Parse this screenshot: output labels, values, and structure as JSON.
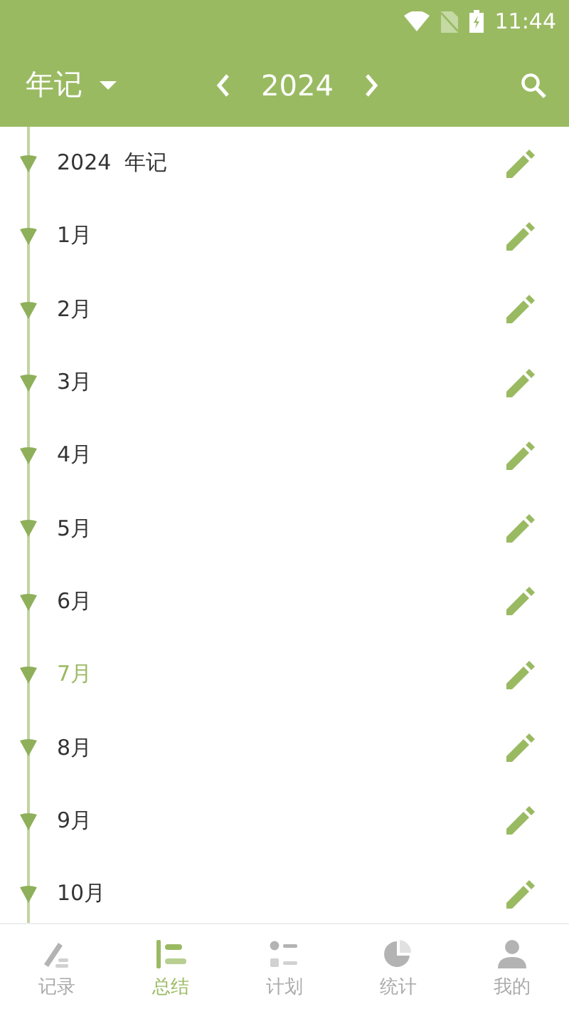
{
  "status_bar": {
    "time": "11:44"
  },
  "header": {
    "view_label": "年记",
    "year": "2024"
  },
  "timeline": [
    {
      "label": "2024  年记",
      "selected": false
    },
    {
      "label": "1月",
      "selected": false
    },
    {
      "label": "2月",
      "selected": false
    },
    {
      "label": "3月",
      "selected": false
    },
    {
      "label": "4月",
      "selected": false
    },
    {
      "label": "5月",
      "selected": false
    },
    {
      "label": "6月",
      "selected": false
    },
    {
      "label": "7月",
      "selected": true
    },
    {
      "label": "8月",
      "selected": false
    },
    {
      "label": "9月",
      "selected": false
    },
    {
      "label": "10月",
      "selected": false
    }
  ],
  "bottom_nav": [
    {
      "kind": "record",
      "label": "记录",
      "selected": false
    },
    {
      "kind": "summary",
      "label": "总结",
      "selected": true
    },
    {
      "kind": "plan",
      "label": "计划",
      "selected": false
    },
    {
      "kind": "stats",
      "label": "统计",
      "selected": false
    },
    {
      "kind": "me",
      "label": "我的",
      "selected": false
    }
  ]
}
